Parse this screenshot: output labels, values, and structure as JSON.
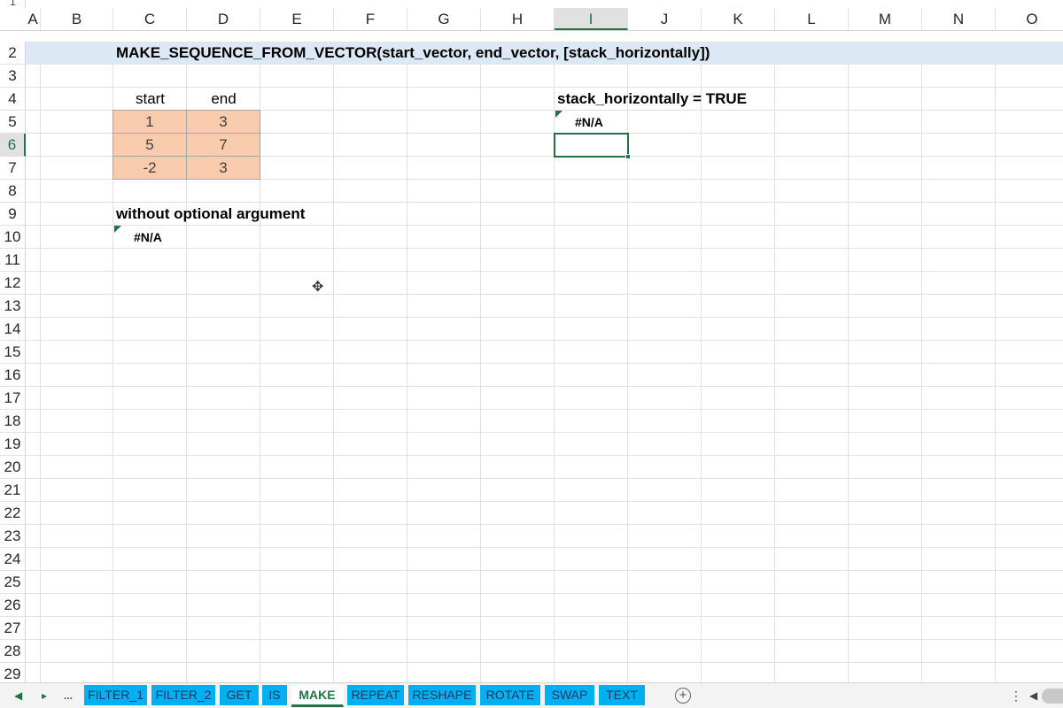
{
  "columns": [
    "A",
    "B",
    "C",
    "D",
    "E",
    "F",
    "G",
    "H",
    "I",
    "J",
    "K",
    "L",
    "M",
    "N",
    "O"
  ],
  "selected_column": "I",
  "rows": [
    "2",
    "3",
    "4",
    "5",
    "6",
    "7",
    "8",
    "9",
    "10",
    "11",
    "12",
    "13",
    "14",
    "15",
    "16",
    "17",
    "18",
    "19",
    "20",
    "21",
    "22",
    "23",
    "24",
    "25",
    "26",
    "27",
    "28",
    "29"
  ],
  "selected_row": "6",
  "top_cut_row": "1",
  "title": "MAKE_SEQUENCE_FROM_VECTOR(start_vector, end_vector, [stack_horizontally])",
  "table": {
    "headers": [
      "start",
      "end"
    ],
    "rows": [
      [
        "1",
        "3"
      ],
      [
        "5",
        "7"
      ],
      [
        "-2",
        "3"
      ]
    ]
  },
  "without_label": "without optional argument",
  "without_result": "#N/A",
  "stack_label": "stack_horizontally = TRUE",
  "stack_result": "#N/A",
  "tabs": {
    "nav_prev": "◀",
    "more": "...",
    "items": [
      "FILTER_1",
      "FILTER_2",
      "GET",
      "IS",
      "MAKE",
      "REPEAT",
      "RESHAPE",
      "ROTATE",
      "SWAP",
      "TEXT"
    ],
    "active": "MAKE",
    "add": "+",
    "menu": "⋮",
    "scroll_left": "◀"
  },
  "colors": {
    "accent": "#217346",
    "tab_bg": "#00b0f0",
    "input_fill": "#f8cbad",
    "title_band": "#dde8f5"
  }
}
